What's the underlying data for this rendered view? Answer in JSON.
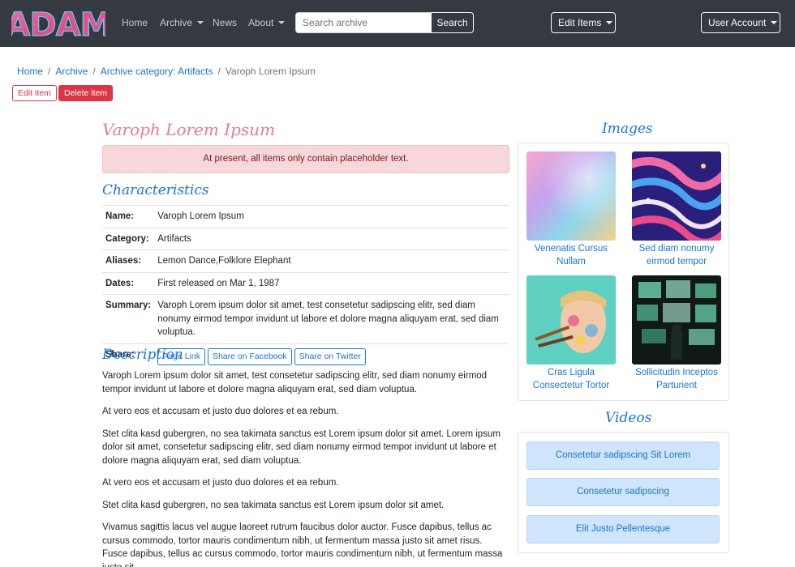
{
  "header": {
    "logo_text": "ADAM",
    "nav": {
      "home": "Home",
      "archive": "Archive",
      "news": "News",
      "about": "About"
    },
    "search": {
      "placeholder": "Search archive",
      "button": "Search"
    },
    "edit_items": "Edit Items",
    "user_account": "User Account"
  },
  "breadcrumb": {
    "home": "Home",
    "archive": "Archive",
    "category": "Archive category: Artifacts",
    "current": "Varoph Lorem Ipsum",
    "separator": "/"
  },
  "actions": {
    "edit": "Edit item",
    "delete": "Delete item"
  },
  "item": {
    "title": "Varoph Lorem Ipsum",
    "alert": "At present, all items only contain placeholder text."
  },
  "characteristics": {
    "heading": "Characteristics",
    "rows": [
      {
        "key": "Name:",
        "value": "Varoph Lorem Ipsum"
      },
      {
        "key": "Category:",
        "value": "Artifacts"
      },
      {
        "key": "Aliases:",
        "value": "Lemon Dance,Folklore Elephant"
      },
      {
        "key": "Dates:",
        "value": "First released on Mar 1, 1987"
      },
      {
        "key": "Summary:",
        "value": "Varoph Lorem ipsum dolor sit amet, test consetetur sadipscing elitr, sed diam nonumy eirmod tempor invidunt ut labore et dolore magna aliquyam erat, sed diam voluptua."
      }
    ],
    "share": {
      "key": "Share:",
      "buttons": [
        "Page Link",
        "Share on Facebook",
        "Share on Twitter"
      ]
    }
  },
  "description": {
    "heading": "Description",
    "paragraphs": [
      "Varoph Lorem ipsum dolor sit amet, test consetetur sadipscing elitr, sed diam nonumy eirmod tempor invidunt ut labore et dolore magna aliquyam erat, sed diam voluptua.",
      "At vero eos et accusam et justo duo dolores et ea rebum.",
      "Stet clita kasd gubergren, no sea takimata sanctus est Lorem ipsum dolor sit amet. Lorem ipsum dolor sit amet, consetetur sadipscing elitr, sed diam nonumy eirmod tempor invidunt ut labore et dolore magna aliquyam erat, sed diam voluptua.",
      "At vero eos et accusam et justo duo dolores et ea rebum.",
      "Stet clita kasd gubergren, no sea takimata sanctus est Lorem ipsum dolor sit amet.",
      "Vivamus sagittis lacus vel augue laoreet rutrum faucibus dolor auctor. Fusce dapibus, tellus ac cursus commodo, tortor mauris condimentum nibh, ut fermentum massa justo sit amet risus. Fusce dapibus, tellus ac cursus commodo, tortor mauris condimentum nibh, ut fermentum massa justo sit"
    ]
  },
  "images": {
    "heading": "Images",
    "items": [
      {
        "caption": "Venenatis Cursus Nullam"
      },
      {
        "caption": "Sed diam nonumy eirmod tempor"
      },
      {
        "caption": "Cras Ligula Consectetur Tortor"
      },
      {
        "caption": "Sollicitudin Inceptos Parturient"
      }
    ]
  },
  "videos": {
    "heading": "Videos",
    "items": [
      "Consetetur sadipscing Sit Lorem",
      "Consetetur sadipscing",
      "Elit Justo Pellentesque"
    ]
  },
  "colors": {
    "navbar": "#343a40",
    "link": "#1a73d8",
    "title_pink": "#e8799b",
    "danger": "#dc3545",
    "alert_bg": "#f8d7da",
    "video_bg": "#cfe5fb"
  }
}
